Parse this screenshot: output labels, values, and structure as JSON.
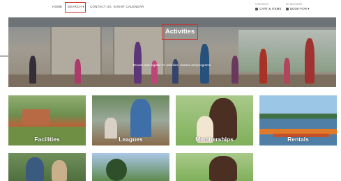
{
  "nav": {
    "items": [
      "HOME",
      "SEARCH ▾",
      "CONTACT US",
      "EVENT CALENDAR"
    ],
    "cart": {
      "small_label": "CHECKOUT",
      "label": "CART & ITEMS"
    },
    "account": {
      "small_label": "MY ACCOUNT",
      "label": "BOOK-FOR ▾"
    }
  },
  "hero": {
    "title": "Activities",
    "subtitle": "Browse and register for activities, classes and programs."
  },
  "tiles": [
    {
      "label": "Facilities"
    },
    {
      "label": "Leagues"
    },
    {
      "label": "Memberships"
    },
    {
      "label": "Rentals"
    }
  ],
  "colors": {
    "highlight": "#d0312d"
  },
  "icons": [
    "cart-icon",
    "account-icon"
  ]
}
